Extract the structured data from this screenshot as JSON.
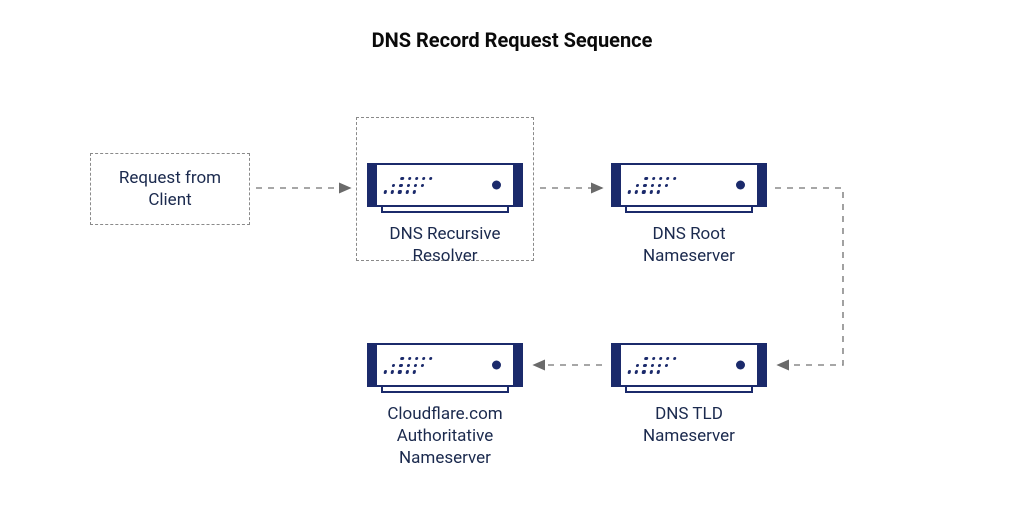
{
  "title": "DNS Record Request Sequence",
  "client": {
    "label": "Request from\nClient"
  },
  "servers": {
    "resolver": {
      "label": "DNS Recursive\nResolver"
    },
    "root": {
      "label": "DNS Root\nNameserver"
    },
    "tld": {
      "label": "DNS TLD\nNameserver"
    },
    "auth": {
      "label": "Cloudflare.com\nAuthoritative\nNameserver"
    }
  },
  "flow": [
    {
      "from": "client",
      "to": "resolver"
    },
    {
      "from": "resolver",
      "to": "root"
    },
    {
      "from": "root",
      "to": "tld"
    },
    {
      "from": "tld",
      "to": "auth"
    }
  ],
  "colors": {
    "text": "#1b2a4e",
    "server_stroke": "#1b2a6b",
    "arrow": "#8a8a8a",
    "dashed_border": "#8a8a8a",
    "background": "#ffffff"
  }
}
